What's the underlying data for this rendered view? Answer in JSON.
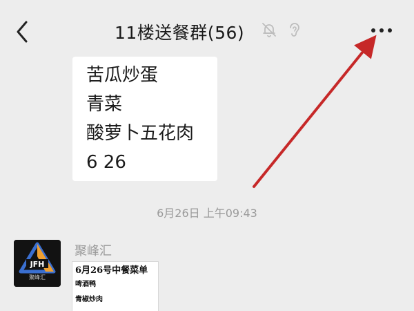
{
  "header": {
    "title": "11楼送餐群(56)",
    "back_icon": "chevron-left-icon",
    "mute_icon": "bell-off-icon",
    "ear_icon": "ear-icon",
    "more_icon": "more-horizontal-icon"
  },
  "messages": [
    {
      "type": "text",
      "lines": [
        "苦瓜炒蛋",
        "青菜",
        "酸萝卜五花肉",
        "6 26"
      ]
    }
  ],
  "timestamp": "6月26日 上午09:43",
  "second_message": {
    "sender": "聚峰汇",
    "avatar_logo_text": "JFH",
    "avatar_caption": "聚峰汇",
    "image_content": {
      "title": "6月26号中餐菜单",
      "items": [
        "啤酒鸭",
        "青椒炒肉"
      ]
    }
  },
  "colors": {
    "background": "#ededed",
    "bubble": "#ffffff",
    "annotation_arrow": "#c62828",
    "timestamp_text": "#9a9a9a",
    "sender_text": "#999999"
  }
}
